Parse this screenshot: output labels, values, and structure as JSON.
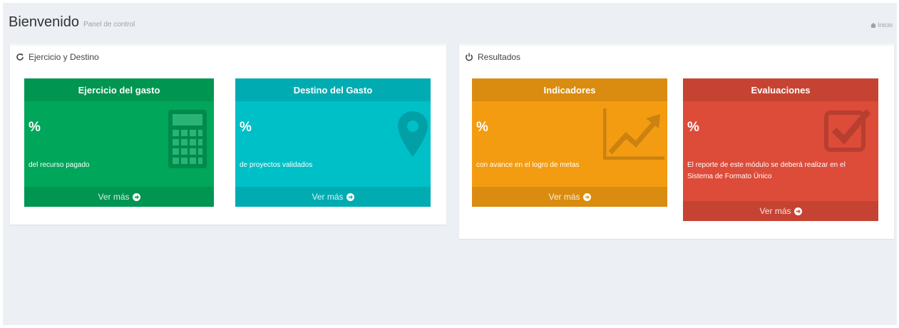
{
  "header": {
    "title": "Bienvenido",
    "subtitle": "Panel de control",
    "breadcrumb": "Inicio"
  },
  "boxes": [
    {
      "title": "Ejercicio y Destino",
      "icon": "refresh-icon",
      "tiles": [
        {
          "title": "Ejercicio del gasto",
          "value": "%",
          "desc": "del recurso pagado",
          "footer": "Ver más",
          "color": "#00a65a",
          "icon": "calculator-icon"
        },
        {
          "title": "Destino del Gasto",
          "value": "%",
          "desc": "de proyectos validados",
          "footer": "Ver más",
          "color": "#00c0c7",
          "icon": "map-marker-icon"
        }
      ]
    },
    {
      "title": "Resultados",
      "icon": "power-icon",
      "tiles": [
        {
          "title": "Indicadores",
          "value": "%",
          "desc": "con avance en el logro de metas",
          "footer": "Ver más",
          "color": "#f39c12",
          "icon": "area-chart-icon"
        },
        {
          "title": "Evaluaciones",
          "value": "%",
          "desc": "El reporte de este módulo se deberá realizar en el Sistema de Formato Único",
          "footer": "Ver más",
          "color": "#dd4b39",
          "icon": "check-square-icon"
        }
      ]
    }
  ]
}
